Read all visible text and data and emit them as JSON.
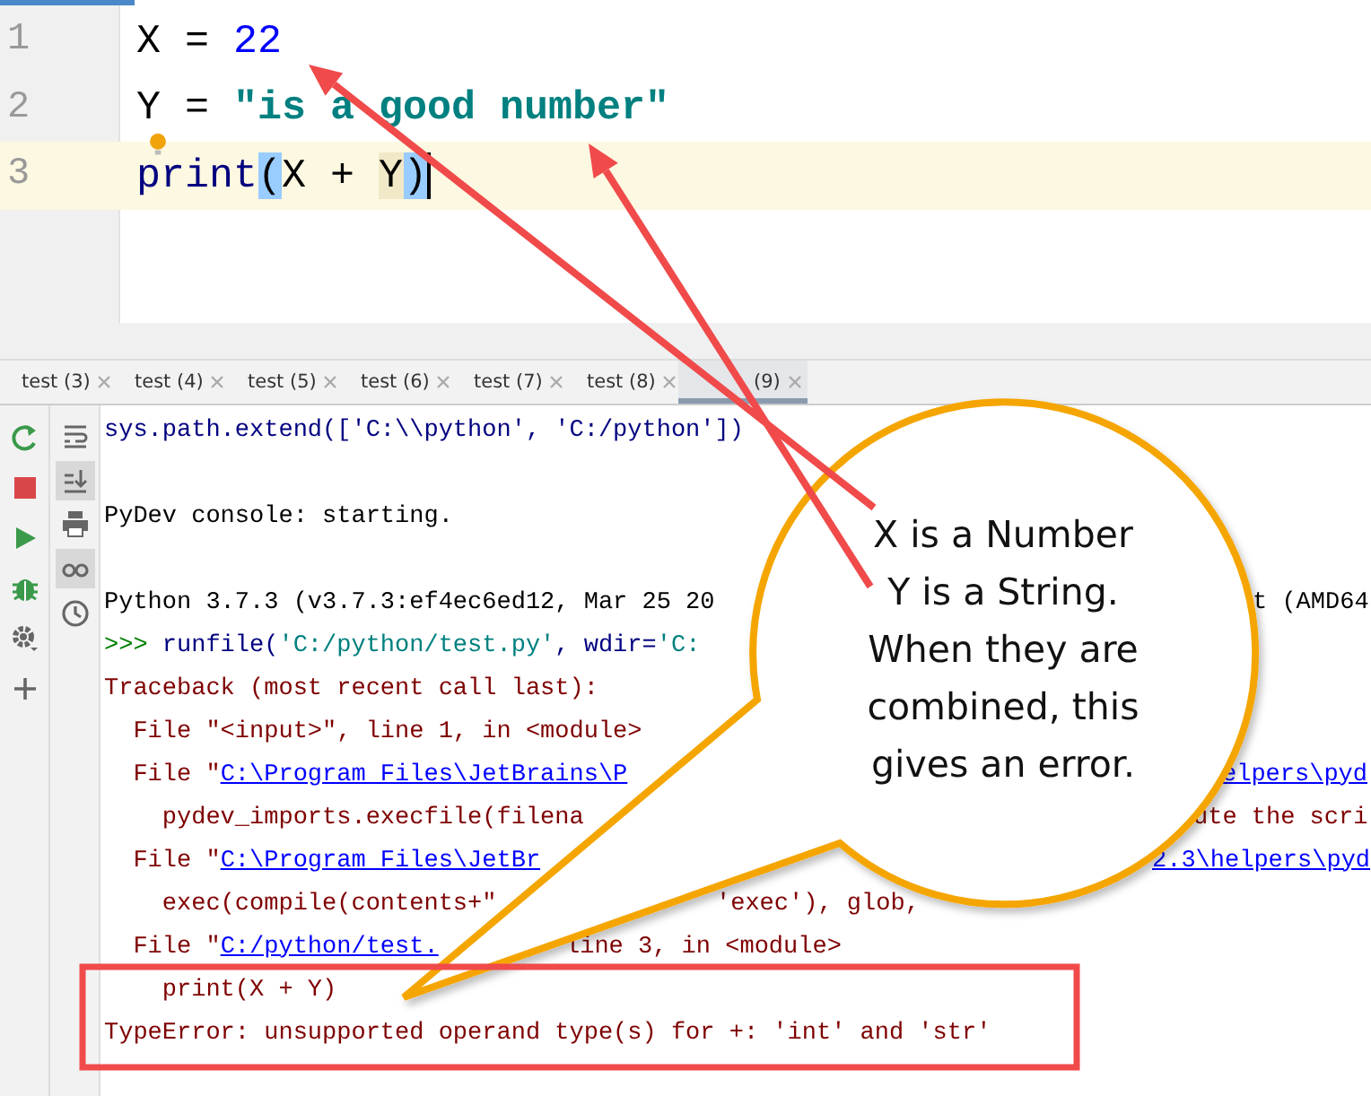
{
  "editor": {
    "lines": [
      {
        "number": "1",
        "current": false,
        "caret": false,
        "hint_bulb": false,
        "tokens": [
          {
            "text": "X = ",
            "kind": "plain"
          },
          {
            "text": "22",
            "kind": "number"
          }
        ]
      },
      {
        "number": "2",
        "current": false,
        "caret": false,
        "hint_bulb": true,
        "tokens": [
          {
            "text": "Y = ",
            "kind": "plain"
          },
          {
            "text": "\"is a good number\"",
            "kind": "string"
          }
        ]
      },
      {
        "number": "3",
        "current": true,
        "caret": true,
        "hint_bulb": false,
        "tokens": [
          {
            "text": "print",
            "kind": "builtin"
          },
          {
            "text": "(",
            "kind": "brace-match"
          },
          {
            "text": "X + ",
            "kind": "plain"
          },
          {
            "text": "Y",
            "kind": "ident-match"
          },
          {
            "text": ")",
            "kind": "brace-match"
          }
        ]
      }
    ]
  },
  "console_tabs": [
    {
      "label": "test (3)",
      "selected": false
    },
    {
      "label": "test (4)",
      "selected": false
    },
    {
      "label": "test (5)",
      "selected": false
    },
    {
      "label": "test (6)",
      "selected": false
    },
    {
      "label": "test (7)",
      "selected": false
    },
    {
      "label": "test (8)",
      "selected": false
    },
    {
      "label": "(9)",
      "selected": true
    }
  ],
  "view_toggles": [
    {
      "on": false
    },
    {
      "on": true
    },
    {
      "on": false
    },
    {
      "on": true
    },
    {
      "on": false
    }
  ],
  "console_blocks": [
    {
      "lines": [
        {
          "parts": [
            {
              "text": "sys.path.extend(['C:\\\\python', 'C:/python'])",
              "kind": "code"
            }
          ]
        }
      ]
    },
    {
      "lines": [
        {
          "parts": [
            {
              "text": "PyDev console: starting.",
              "kind": "plain"
            }
          ]
        }
      ]
    },
    {
      "lines": [
        {
          "parts": [
            {
              "text": "Python 3.7.3 (v3.7.3:ef4ec6ed12, Mar 25 20",
              "kind": "plain"
            }
          ],
          "continued": [
            {
              "text": "t (AMD64",
              "kind": "plain"
            }
          ]
        },
        {
          "parts": [
            {
              "text": ">>> ",
              "kind": "prompt"
            },
            {
              "text": "runfile(",
              "kind": "code"
            },
            {
              "text": "'C:/python/test.py'",
              "kind": "string"
            },
            {
              "text": ", wdir=",
              "kind": "code"
            },
            {
              "text": "'C:",
              "kind": "string"
            }
          ]
        },
        {
          "parts": [
            {
              "text": "Traceback (most recent call last):",
              "kind": "error"
            }
          ]
        },
        {
          "parts": [
            {
              "text": "  File \"<input>\", line 1, in <module>",
              "kind": "error"
            }
          ]
        },
        {
          "parts": [
            {
              "text": "  File \"",
              "kind": "error"
            },
            {
              "text": "C:\\Program Files\\JetBrains\\P",
              "kind": "link"
            }
          ],
          "continued": [
            {
              "text": "elpers\\pyd",
              "kind": "link"
            }
          ]
        },
        {
          "parts": [
            {
              "text": "    pydev_imports.execfile(filena",
              "kind": "error"
            }
          ],
          "continued": [
            {
              "text": "ute the scri",
              "kind": "error"
            }
          ]
        },
        {
          "parts": [
            {
              "text": "  File \"",
              "kind": "error"
            },
            {
              "text": "C:\\Program Files\\JetBr",
              "kind": "link"
            }
          ],
          "continued": [
            {
              "text": "2.3\\helpers\\pyd",
              "kind": "link"
            }
          ]
        },
        {
          "parts": [
            {
              "text": "    exec(compile(contents+\"",
              "kind": "error"
            }
          ],
          "continued": [
            {
              "text": "'exec'), glob,",
              "kind": "error"
            }
          ]
        },
        {
          "parts": [
            {
              "text": "  File \"",
              "kind": "error"
            },
            {
              "text": "C:/python/test.",
              "kind": "link"
            }
          ],
          "continued": [
            {
              "text": "line 3, in <module>",
              "kind": "error"
            }
          ]
        },
        {
          "parts": [
            {
              "text": "    print(X + Y)",
              "kind": "error"
            }
          ]
        },
        {
          "parts": [
            {
              "text": "TypeError: unsupported operand type(s) for +: 'int' and 'str'",
              "kind": "error"
            }
          ]
        }
      ]
    }
  ],
  "callout": {
    "text": "X is a Number\nY is a String.\nWhen they are\ncombined, this\ngives an error."
  }
}
